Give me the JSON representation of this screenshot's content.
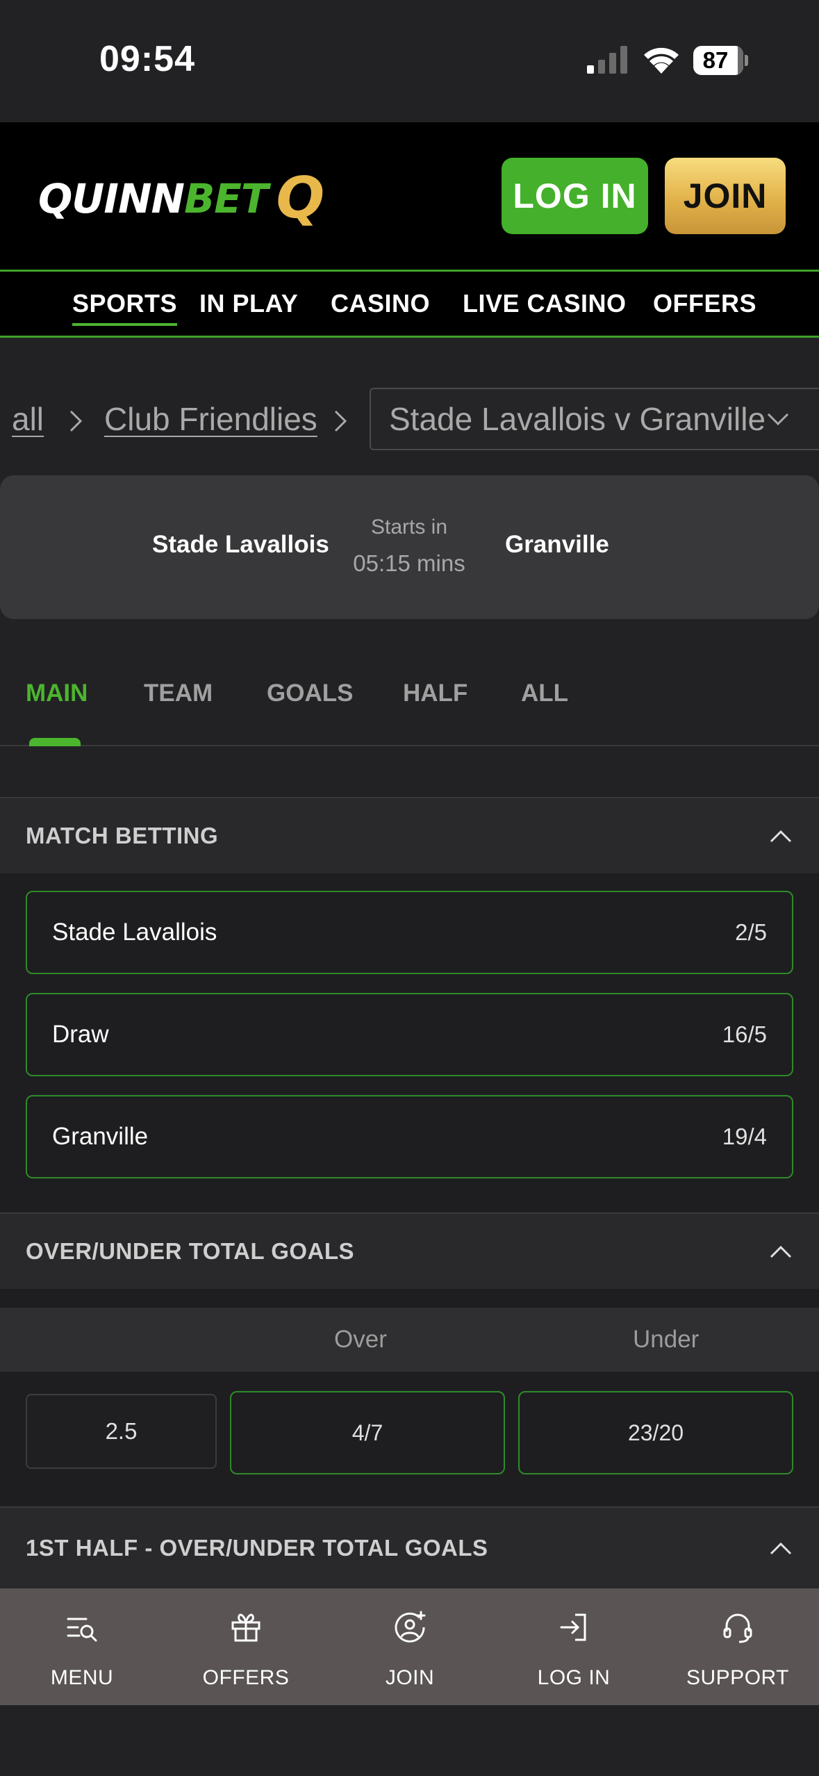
{
  "status_bar": {
    "time": "09:54",
    "battery_level": "87",
    "battery_fraction": 0.87,
    "signal_bars_active": 1,
    "signal_bars_total": 4
  },
  "header": {
    "logo_part1": "QUINN",
    "logo_part2": "BET",
    "logo_mark": "Q",
    "login_label": "LOG IN",
    "join_label": "JOIN"
  },
  "nav": {
    "items": [
      {
        "label": "SPORTS",
        "active": true
      },
      {
        "label": "IN PLAY",
        "active": false
      },
      {
        "label": "CASINO",
        "active": false
      },
      {
        "label": "LIVE CASINO",
        "active": false
      },
      {
        "label": "OFFERS",
        "active": false
      }
    ]
  },
  "breadcrumb": {
    "items": [
      "all",
      "Club Friendlies"
    ],
    "selected_event": "Stade Lavallois v Granville"
  },
  "match": {
    "home": "Stade Lavallois",
    "away": "Granville",
    "starts_label": "Starts in",
    "starts_time": "05:15 mins"
  },
  "market_tabs": [
    {
      "label": "MAIN",
      "active": true
    },
    {
      "label": "TEAM",
      "active": false
    },
    {
      "label": "GOALS",
      "active": false
    },
    {
      "label": "HALF",
      "active": false
    },
    {
      "label": "ALL",
      "active": false
    }
  ],
  "match_betting": {
    "title": "MATCH BETTING",
    "selections": [
      {
        "name": "Stade Lavallois",
        "price": "2/5"
      },
      {
        "name": "Draw",
        "price": "16/5"
      },
      {
        "name": "Granville",
        "price": "19/4"
      }
    ]
  },
  "over_under": {
    "title": "OVER/UNDER TOTAL GOALS",
    "over_label": "Over",
    "under_label": "Under",
    "line": "2.5",
    "over_price": "4/7",
    "under_price": "23/20"
  },
  "first_half_ou": {
    "title": "1ST HALF - OVER/UNDER TOTAL GOALS"
  },
  "bottom_nav": {
    "items": [
      {
        "label": "MENU",
        "icon": "menu-search-icon"
      },
      {
        "label": "OFFERS",
        "icon": "gift-icon"
      },
      {
        "label": "JOIN",
        "icon": "user-add-icon"
      },
      {
        "label": "LOG IN",
        "icon": "login-icon"
      },
      {
        "label": "SUPPORT",
        "icon": "headset-icon"
      }
    ]
  },
  "colors": {
    "brand_green": "#4cb52e",
    "gold": "#e2b24a",
    "background": "#222224"
  }
}
